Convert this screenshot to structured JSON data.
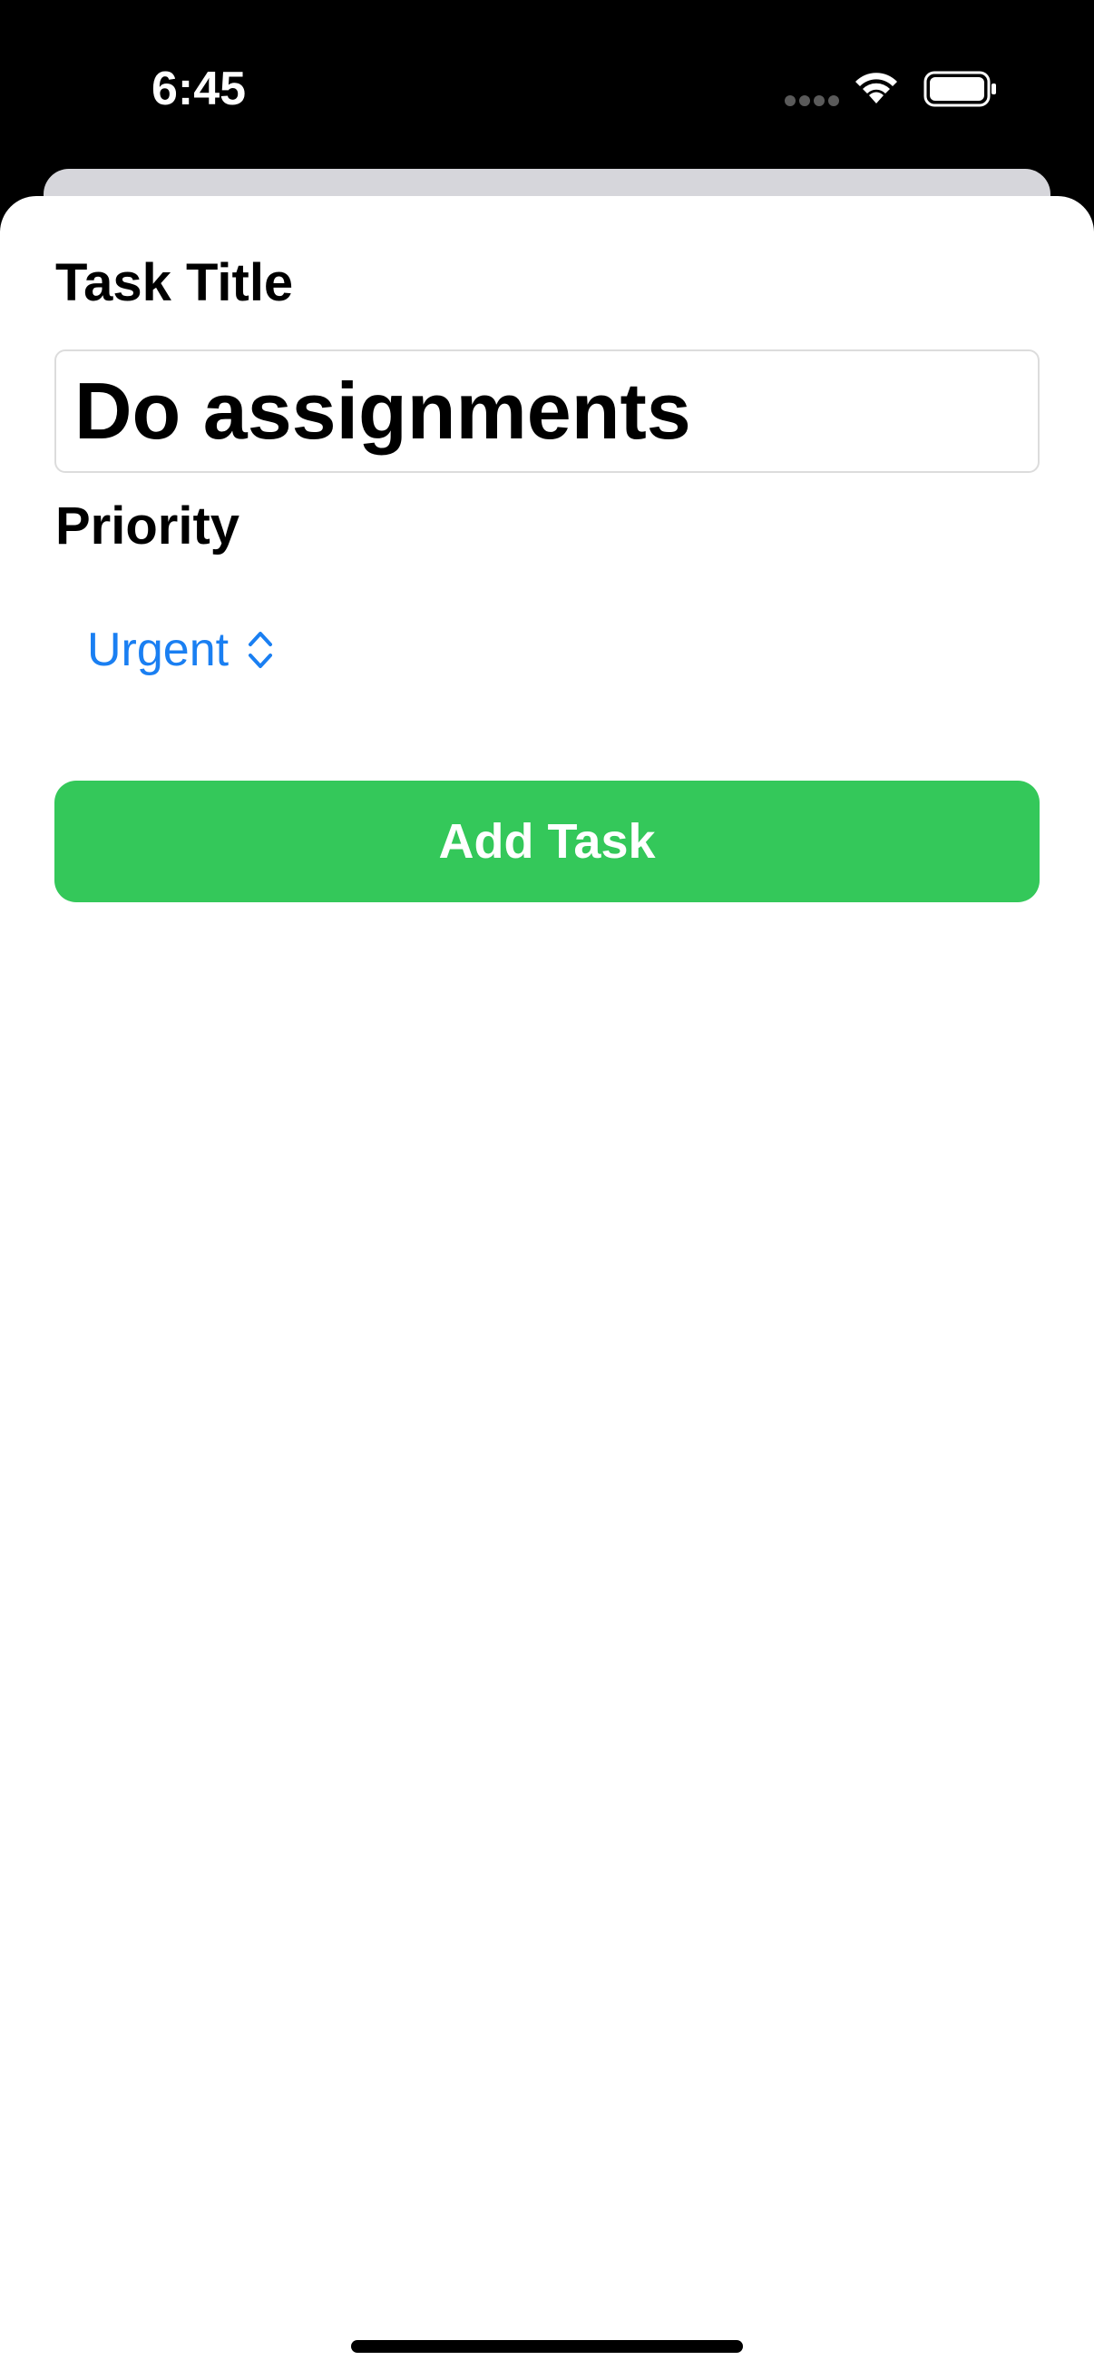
{
  "status_bar": {
    "time": "6:45",
    "icons": [
      "signal-dots-icon",
      "wifi-icon",
      "battery-icon"
    ]
  },
  "form": {
    "title_label": "Task Title",
    "title_value": "Do assignments",
    "priority_label": "Priority",
    "priority_value": "Urgent",
    "add_button_label": "Add Task"
  },
  "colors": {
    "accent_blue": "#1a7ff2",
    "button_green": "#34c85a",
    "background": "#ffffff",
    "status_bar": "#000000"
  }
}
